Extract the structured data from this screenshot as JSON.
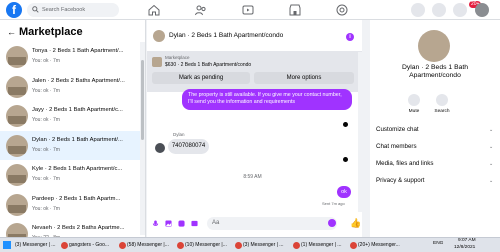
{
  "topbar": {
    "search_placeholder": "Search Facebook",
    "notifications_badge": "20+",
    "logo": "f"
  },
  "sidebar": {
    "title": "Marketplace",
    "items": [
      {
        "title": "Tonya · 2 Beds 1 Bath Apartment/...",
        "meta": "You: ok · 7m"
      },
      {
        "title": "Jalen · 2 Beds 2 Baths Apartment/...",
        "meta": "You: ok · 7m"
      },
      {
        "title": "Jayy · 2 Beds 1 Bath Apartment/c...",
        "meta": "You: ok · 7m"
      },
      {
        "title": "Dylan · 2 Beds 1 Bath Apartment/...",
        "meta": "You: ok · 7m"
      },
      {
        "title": "Kyle · 2 Beds 1 Bath Apartment/c...",
        "meta": "You: ok · 7m"
      },
      {
        "title": "Pardeep · 2 Beds 1 Bath Apartm...",
        "meta": "You: ok · 7m"
      },
      {
        "title": "Nevaeh · 2 Beds 2 Baths Apartme...",
        "meta": "You: ?? · 8m"
      }
    ]
  },
  "chat": {
    "header_title": "Dylan · 2 Beds 1 Bath Apartment/condo",
    "listing_label": "Marketplace",
    "listing_desc": "$630 · 2 Beds 1 Bath Apartment/condo",
    "mark_pending_label": "Mark as pending",
    "more_options_label": "More options",
    "outgoing_message": "The property is still available. If you give me your contact number, I'll send you the information and requirements",
    "sender_name": "Dylan",
    "incoming_message": "7407080074",
    "time_separator": "8:59 AM",
    "reply": "ok",
    "sent_status": "Sent 7m ago",
    "composer_placeholder": "Aa"
  },
  "right_panel": {
    "title": "Dylan · 2 Beds 1 Bath Apartment/condo",
    "mute_label": "Mute",
    "search_label": "Search",
    "menu": [
      "Customize chat",
      "Chat members",
      "Media, files and links",
      "Privacy & support"
    ]
  },
  "taskbar": {
    "apps": [
      "gangsters - Goo...",
      "(58) Messenger |...",
      "(10) Messenger |...",
      "(3) Messenger | ...",
      "(1) Messenger | ...",
      "(20+) Messenger...",
      "(3) Messenger | ..."
    ],
    "language": "ENG",
    "time": "9:07 AM",
    "date": "12/8/2021"
  },
  "colors": {
    "accent": "#a033ff",
    "facebook_blue": "#1877f2"
  }
}
